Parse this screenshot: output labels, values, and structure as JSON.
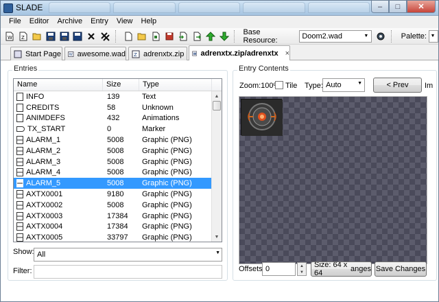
{
  "window": {
    "title": "SLADE"
  },
  "menu": [
    "File",
    "Editor",
    "Archive",
    "Entry",
    "View",
    "Help"
  ],
  "toolbar": {
    "icons": [
      "new-archive-icon",
      "new-zip-icon",
      "open-icon",
      "save-icon",
      "save-as-icon",
      "save-all-icon",
      "close-archive-icon",
      "close-all-icon",
      "new-entry-icon",
      "new-directory-icon",
      "import-files-icon",
      "export-icon",
      "rename-icon",
      "delete-icon",
      "move-up-icon",
      "move-down-icon",
      "settings-gear-icon"
    ],
    "base_resource_label": "Base Resource:",
    "base_resource_value": "Doom2.wad",
    "palette_label": "Palette:"
  },
  "tabs": [
    {
      "label": "Start Page",
      "icon": "start-page-icon",
      "active": false
    },
    {
      "label": "awesome.wad",
      "icon": "wad-icon",
      "active": false
    },
    {
      "label": "adrenxtx.zip",
      "icon": "zip-icon",
      "active": false
    },
    {
      "label": "adrenxtx.zip/adrenxtx",
      "icon": "wad-icon",
      "active": true,
      "close": "×"
    }
  ],
  "entries": {
    "label": "Entries",
    "columns": [
      "Name",
      "Size",
      "Type"
    ],
    "rows": [
      {
        "name": "INFO",
        "size": "139",
        "type": "Text",
        "icon": "text-file-icon"
      },
      {
        "name": "CREDITS",
        "size": "58",
        "type": "Unknown",
        "icon": "unknown-file-icon"
      },
      {
        "name": "ANIMDEFS",
        "size": "432",
        "type": "Animations",
        "icon": "text-file-icon"
      },
      {
        "name": "TX_START",
        "size": "0",
        "type": "Marker",
        "icon": "marker-icon"
      },
      {
        "name": "ALARM_1",
        "size": "5008",
        "type": "Graphic (PNG)",
        "icon": "graphic-icon"
      },
      {
        "name": "ALARM_2",
        "size": "5008",
        "type": "Graphic (PNG)",
        "icon": "graphic-icon"
      },
      {
        "name": "ALARM_3",
        "size": "5008",
        "type": "Graphic (PNG)",
        "icon": "graphic-icon"
      },
      {
        "name": "ALARM_4",
        "size": "5008",
        "type": "Graphic (PNG)",
        "icon": "graphic-icon"
      },
      {
        "name": "ALARM_5",
        "size": "5008",
        "type": "Graphic (PNG)",
        "icon": "graphic-icon",
        "selected": true
      },
      {
        "name": "AXTX0001",
        "size": "9180",
        "type": "Graphic (PNG)",
        "icon": "graphic-icon"
      },
      {
        "name": "AXTX0002",
        "size": "5008",
        "type": "Graphic (PNG)",
        "icon": "graphic-icon"
      },
      {
        "name": "AXTX0003",
        "size": "17384",
        "type": "Graphic (PNG)",
        "icon": "graphic-icon"
      },
      {
        "name": "AXTX0004",
        "size": "17384",
        "type": "Graphic (PNG)",
        "icon": "graphic-icon"
      },
      {
        "name": "AXTX0005",
        "size": "33797",
        "type": "Graphic (PNG)",
        "icon": "graphic-icon"
      }
    ],
    "show_label": "Show:",
    "show_value": "All",
    "filter_label": "Filter:",
    "filter_value": ""
  },
  "contents": {
    "label": "Entry Contents",
    "zoom_label": "Zoom:100%",
    "tile_label": "Tile",
    "type_label": "Type:",
    "type_value": "Auto",
    "prev_button": "< Prev",
    "next_button_partial": "Im",
    "offsets_label": "Offsets:",
    "offset_value": "0",
    "size_button": "Size: 64 x 64",
    "size_button_suffix": "anges",
    "save_button": "Save Changes"
  },
  "colors": {
    "selection": "#3399ff",
    "titlebar": "#b9d3ea",
    "checker_dark": "#4a4a5a",
    "checker_light": "#5c5c6c"
  }
}
